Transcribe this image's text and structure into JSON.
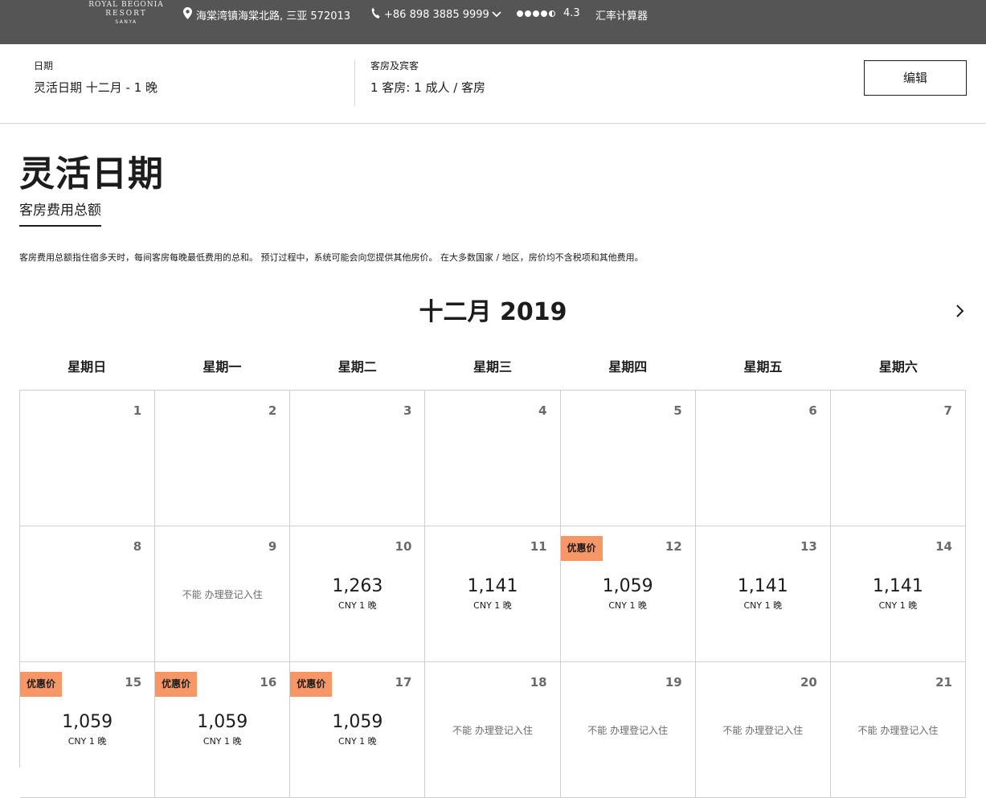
{
  "header": {
    "logo_line1": "ROYAL BEGONIA",
    "logo_line2": "RESORT",
    "logo_line3": "SANYA",
    "address": "海棠湾镇海棠北路, 三亚  572013",
    "phone": "+86 898 3885 9999",
    "rating_value": "4.3",
    "rating_icon": "rating-dots",
    "currency_link": "汇率计算器"
  },
  "summary": {
    "dates_label": "日期",
    "dates_value": "灵活日期 十二月 - 1 晚",
    "rooms_label": "客房及宾客",
    "rooms_value": "1 客房: 1 成人 / 客房",
    "edit_label": "编辑"
  },
  "page": {
    "title": "灵活日期",
    "tab": "客房费用总额",
    "note": "客房费用总额指住宿多天时，每间客房每晚最低费用的总和。 预订过程中，系统可能会向您提供其他房价。 在大多数国家 / 地区，房价均不含税项和其他费用。"
  },
  "calendar": {
    "month": "十二月 2019",
    "weekdays": [
      "星期日",
      "星期一",
      "星期二",
      "星期三",
      "星期四",
      "星期五",
      "星期六"
    ],
    "days": [
      {
        "day": "1"
      },
      {
        "day": "2"
      },
      {
        "day": "3"
      },
      {
        "day": "4"
      },
      {
        "day": "5"
      },
      {
        "day": "6"
      },
      {
        "day": "7"
      },
      {
        "day": "8"
      },
      {
        "day": "9",
        "na": "不能 办理登记入住"
      },
      {
        "day": "10",
        "price": "1,263",
        "per": "CNY 1 晚"
      },
      {
        "day": "11",
        "price": "1,141",
        "per": "CNY 1 晚"
      },
      {
        "day": "12",
        "price": "1,059",
        "per": "CNY 1 晚",
        "badge": "优惠价"
      },
      {
        "day": "13",
        "price": "1,141",
        "per": "CNY 1 晚"
      },
      {
        "day": "14",
        "price": "1,141",
        "per": "CNY 1 晚"
      },
      {
        "day": "15",
        "price": "1,059",
        "per": "CNY 1 晚",
        "badge": "优惠价"
      },
      {
        "day": "16",
        "price": "1,059",
        "per": "CNY 1 晚",
        "badge": "优惠价"
      },
      {
        "day": "17",
        "price": "1,059",
        "per": "CNY 1 晚",
        "badge": "优惠价"
      },
      {
        "day": "18",
        "na": "不能 办理登记入住"
      },
      {
        "day": "19",
        "na": "不能 办理登记入住"
      },
      {
        "day": "20",
        "na": "不能 办理登记入住"
      },
      {
        "day": "21",
        "na": "不能 办理登记入住"
      }
    ]
  },
  "colors": {
    "topbar": "#555555",
    "badge": "#f79767",
    "border": "#cfcfcf"
  }
}
